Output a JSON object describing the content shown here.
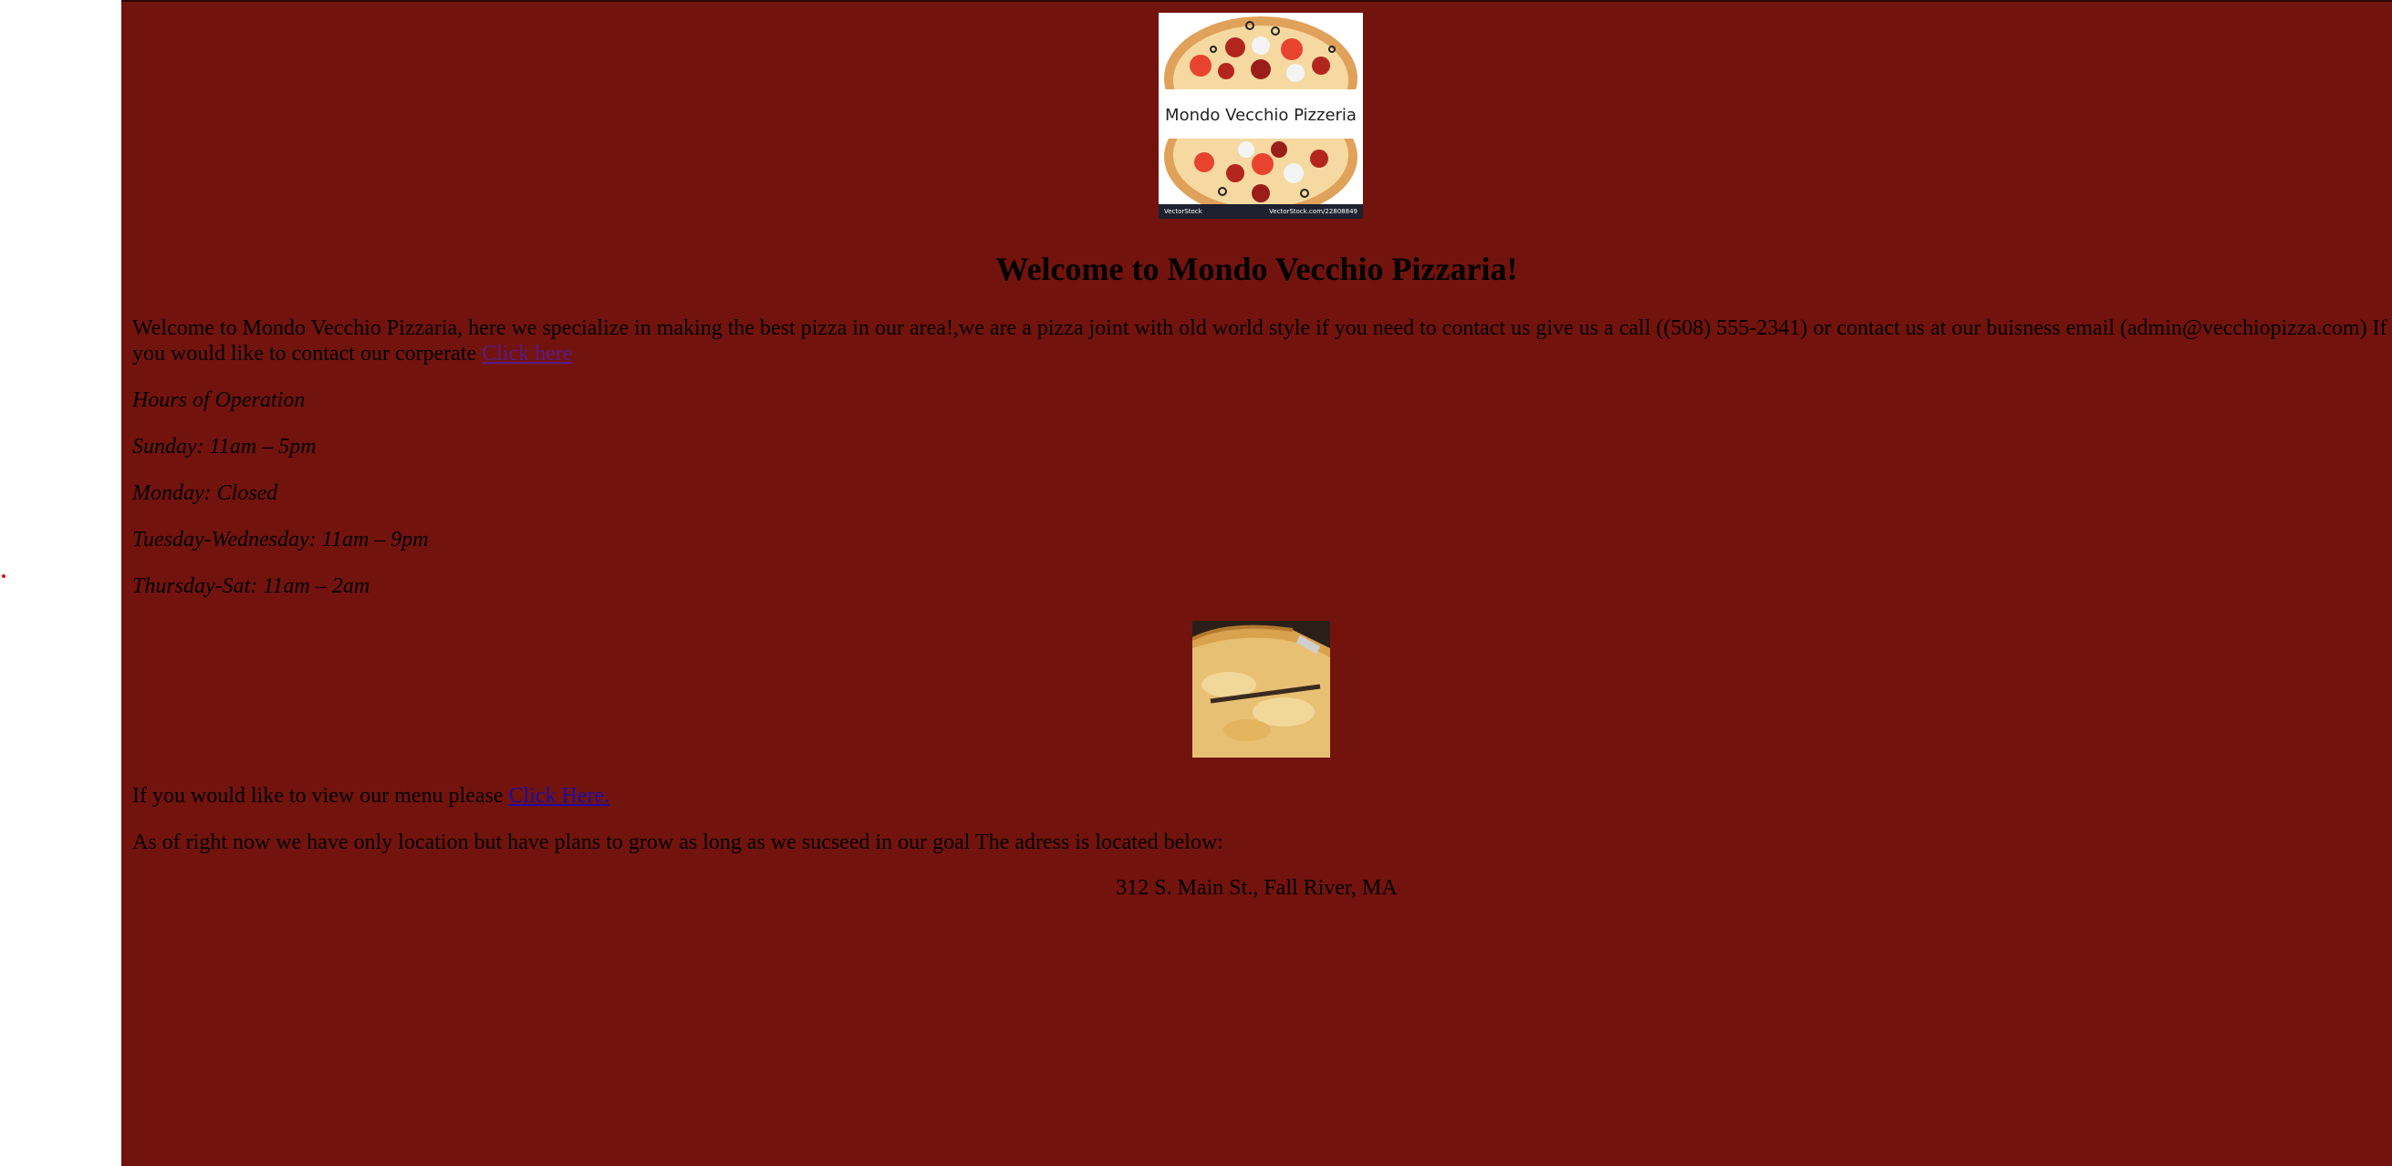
{
  "logo": {
    "text": "Mondo Vecchio Pizzeria",
    "stock_left": "VectorStock",
    "stock_right": "VectorStock.com/22808849"
  },
  "title": "Welcome to Mondo Vecchio Pizzaria!",
  "intro": {
    "text": "Welcome to Mondo Vecchio Pizzaria, here we specialize in making the best pizza in our area!,we are a pizza joint with old world style if you need to contact us give us a call ((508) 555-2341) or contact us at our buisness email (admin@vecchiopizza.com) If you would like to contact our corperate ",
    "link": "Click here"
  },
  "hours": {
    "heading": "Hours of Operation",
    "sunday": "Sunday: 11am – 5pm",
    "monday": "Monday: Closed",
    "tue_wed": "Tuesday-Wednesday: 11am – 9pm",
    "thu_sat": "Thursday-Sat: 11am – 2am"
  },
  "menu": {
    "text": "If you would like to view our menu please ",
    "link": "Click Here."
  },
  "location_text": "As of right now we have only location but have plans to grow as long as we sucseed in our goal The adress is located below:",
  "address": "312 S. Main St., Fall River, MA",
  "colors": {
    "page_background": "#73130d",
    "link": "#1a0dab",
    "visited_link": "#5a1a8a"
  }
}
